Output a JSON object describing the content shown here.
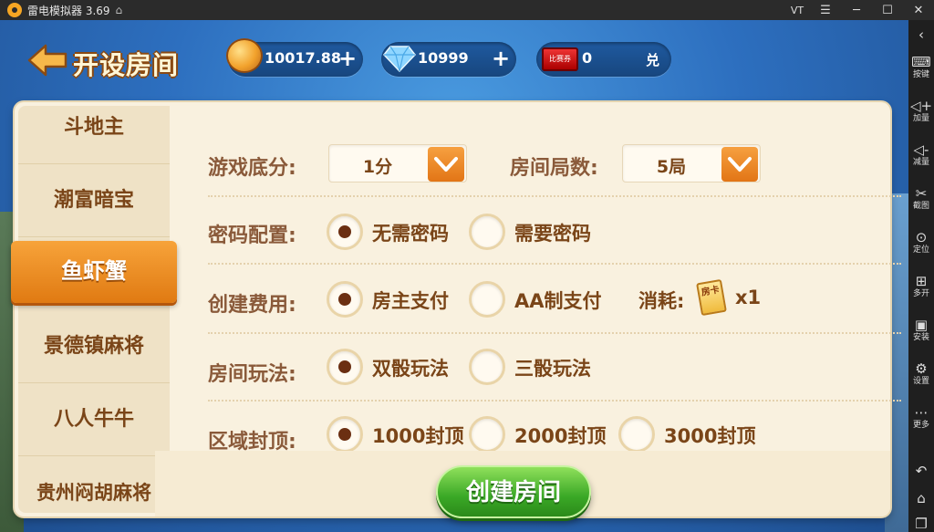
{
  "emulator": {
    "title": "雷电模拟器 3.69",
    "vt_label": "VT",
    "toolbar": [
      {
        "label": "",
        "icon": "collapse-icon"
      },
      {
        "label": "按键",
        "icon": "keyboard-icon"
      },
      {
        "label": "加量",
        "icon": "volume-up-icon"
      },
      {
        "label": "减量",
        "icon": "volume-down-icon"
      },
      {
        "label": "截图",
        "icon": "scissors-icon"
      },
      {
        "label": "定位",
        "icon": "location-icon"
      },
      {
        "label": "多开",
        "icon": "multi-instance-icon"
      },
      {
        "label": "安装",
        "icon": "apk-icon"
      },
      {
        "label": "设置",
        "icon": "gear-icon"
      },
      {
        "label": "更多",
        "icon": "more-icon"
      }
    ]
  },
  "header": {
    "title": "开设房间",
    "gold": "10017.88",
    "diamonds": "10999",
    "tickets": "0",
    "ticket_icon_label": "比赛券",
    "exchange_label": "兑"
  },
  "sidebar": {
    "items": [
      "斗地主",
      "潮富暗宝",
      "鱼虾蟹",
      "景德镇麻将",
      "八人牛牛",
      "贵州闷胡麻将"
    ],
    "selected": "鱼虾蟹"
  },
  "form": {
    "base_score": {
      "label": "游戏底分:",
      "value": "1分"
    },
    "rounds": {
      "label": "房间局数:",
      "value": "5局"
    },
    "password": {
      "label": "密码配置:",
      "options": [
        "无需密码",
        "需要密码"
      ],
      "selected": "无需密码"
    },
    "fee": {
      "label": "创建费用:",
      "options": [
        "房主支付",
        "AA制支付"
      ],
      "selected": "房主支付",
      "cost_label": "消耗:",
      "card_text": "房卡",
      "cost_count": "x1"
    },
    "play": {
      "label": "房间玩法:",
      "options": [
        "双骰玩法",
        "三骰玩法"
      ],
      "selected": "双骰玩法"
    },
    "cap": {
      "label": "区域封顶:",
      "options": [
        "1000封顶",
        "2000封顶",
        "3000封顶"
      ],
      "selected": "1000封顶"
    }
  },
  "actions": {
    "create_label": "创建房间"
  }
}
